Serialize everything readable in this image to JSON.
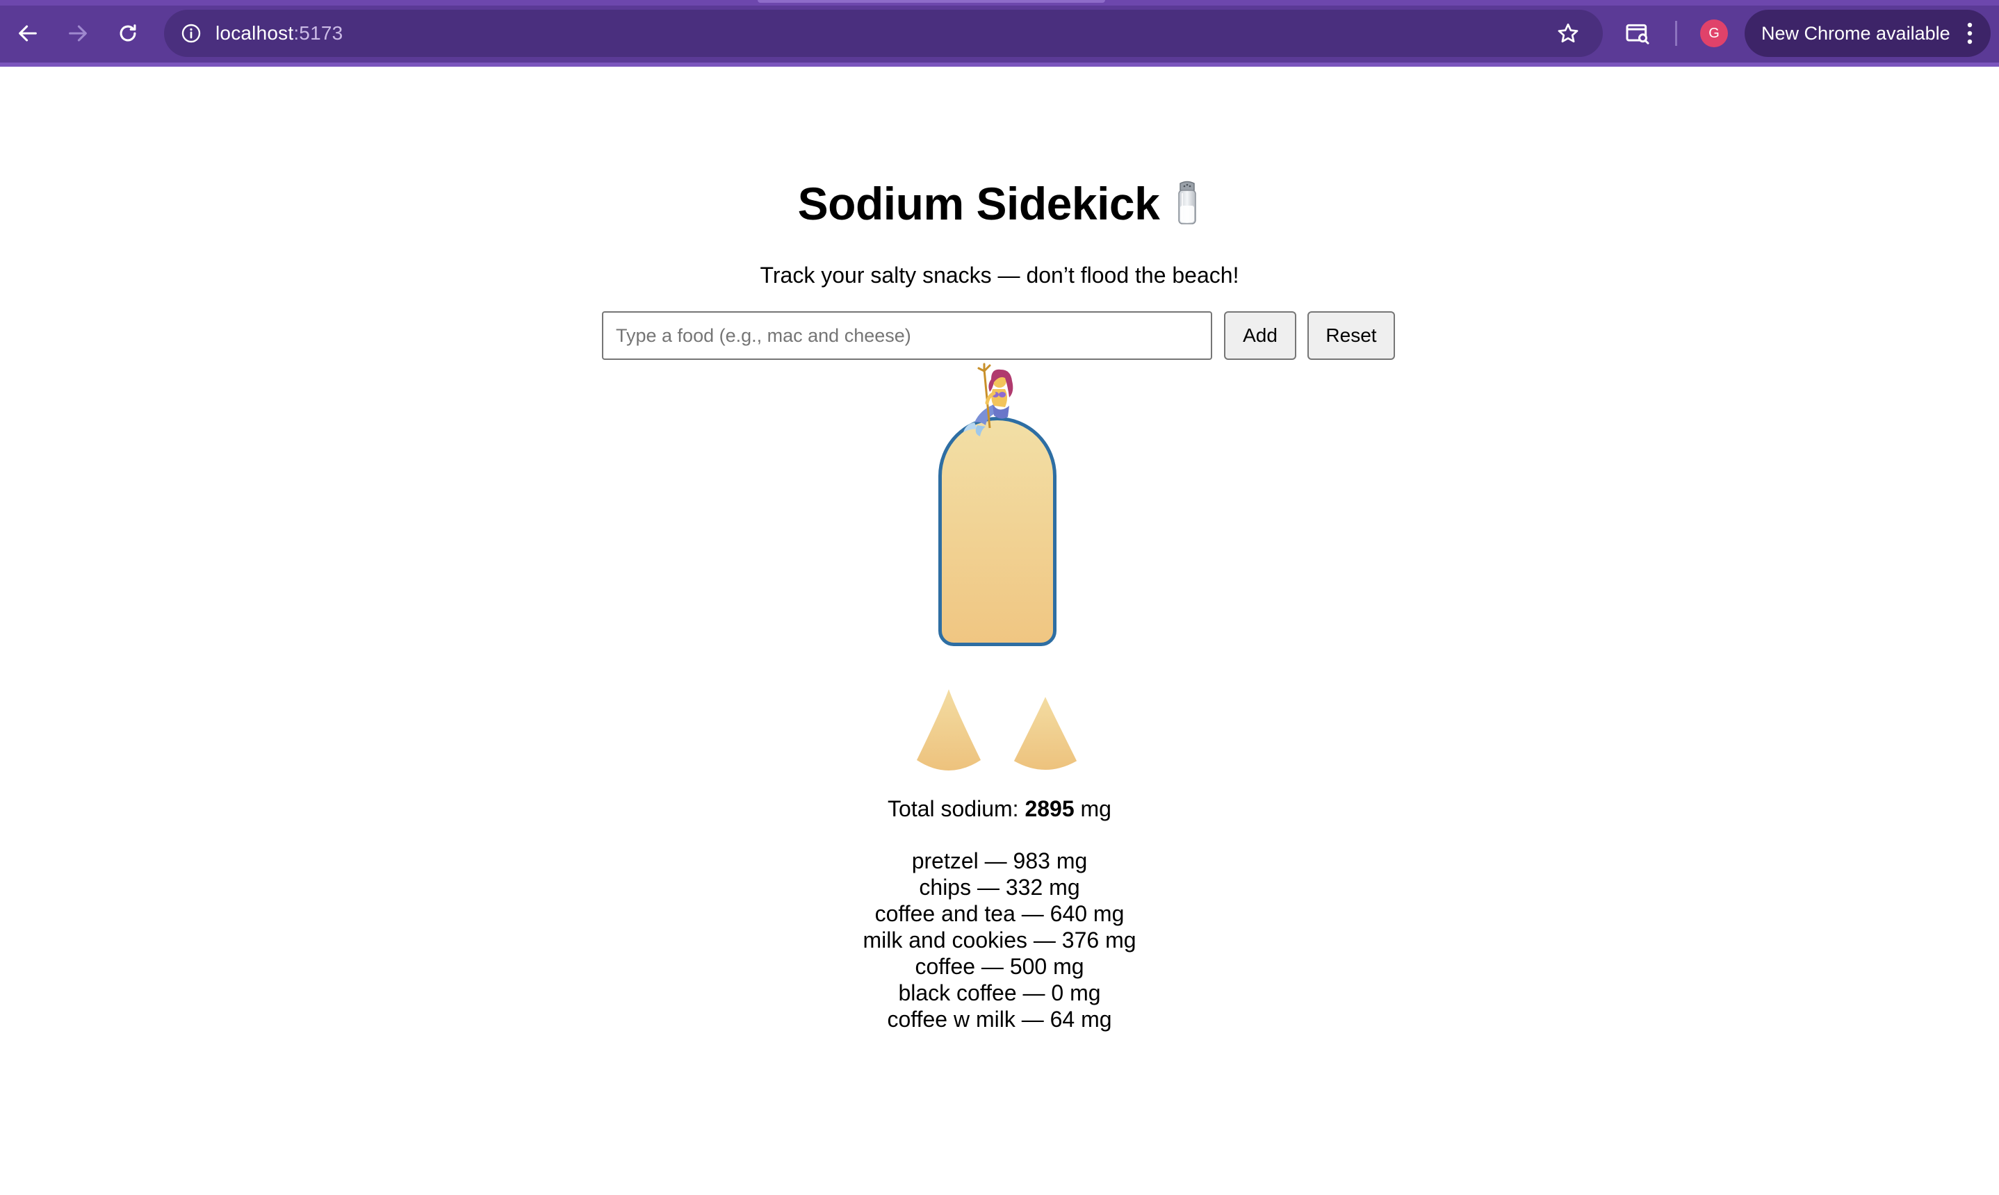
{
  "browser": {
    "url_host": "localhost",
    "url_port": ":5173",
    "profile_initial": "G",
    "update_label": "New Chrome available",
    "theme_color": "#5b3a96"
  },
  "page": {
    "title": "Sodium Sidekick",
    "title_emoji": "salt-shaker-icon",
    "subtitle": "Track your salty snacks — don’t flood the beach!",
    "input_placeholder": "Type a food (e.g., mac and cheese)",
    "input_value": "",
    "add_label": "Add",
    "reset_label": "Reset",
    "total_prefix": "Total sodium:",
    "total_value": "2895",
    "total_unit": "mg",
    "bottle_border_color": "#2e6ea3",
    "sand_color": "#f0c682"
  },
  "entries": [
    "pretzel — 983 mg",
    "chips — 332 mg",
    "coffee and tea — 640 mg",
    "milk and cookies — 376 mg",
    "coffee — 500 mg",
    "black coffee — 0 mg",
    "coffee w milk — 64 mg"
  ]
}
